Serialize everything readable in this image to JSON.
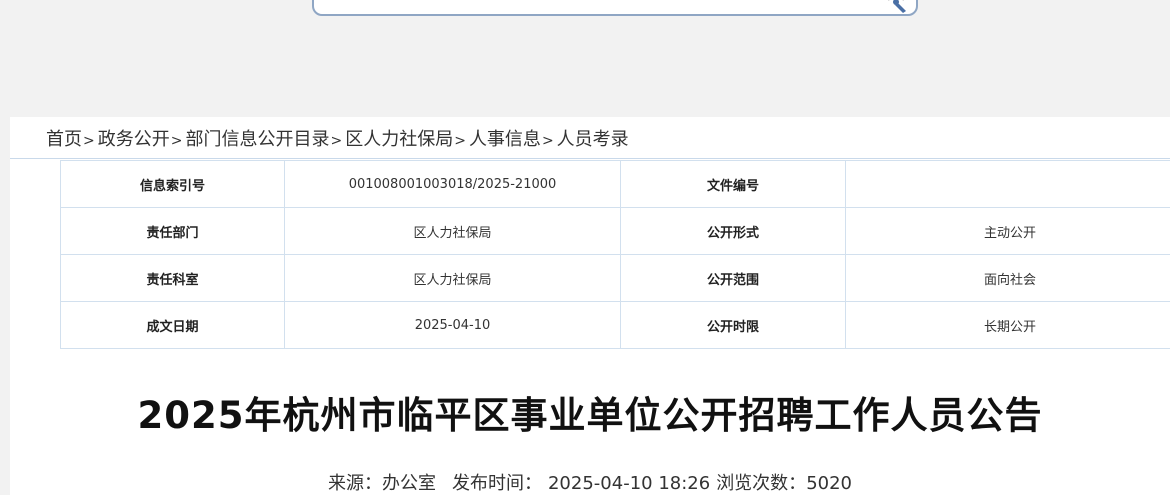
{
  "search": {
    "value": "",
    "placeholder": ""
  },
  "breadcrumb": [
    {
      "label": "首页"
    },
    {
      "label": "政务公开"
    },
    {
      "label": "部门信息公开目录"
    },
    {
      "label": "区人力社保局"
    },
    {
      "label": "人事信息"
    },
    {
      "label": "人员考录"
    }
  ],
  "breadcrumb_sep": ">",
  "info_table": {
    "index_label": "信息索引号",
    "index_value": "001008001003018/2025-21000",
    "docno_label": "文件编号",
    "docno_value": "",
    "dept_label": "责任部门",
    "dept_value": "区人力社保局",
    "form_label": "公开形式",
    "form_value": "主动公开",
    "office_label": "责任科室",
    "office_value": "区人力社保局",
    "scope_label": "公开范围",
    "scope_value": "面向社会",
    "date_label": "成文日期",
    "date_value": "2025-04-10",
    "limit_label": "公开时限",
    "limit_value": "长期公开"
  },
  "article": {
    "title": "2025年杭州市临平区事业单位公开招聘工作人员公告",
    "source_label": "来源：",
    "source_value": "办公室",
    "publish_label": "发布时间：",
    "publish_value": "2025-04-10 18:26",
    "views_label": "浏览次数：",
    "views_value": "5020"
  },
  "colors": {
    "border": "#d2e0ee",
    "search_border": "#8fa6c4",
    "page_bg": "#f2f2f2"
  }
}
